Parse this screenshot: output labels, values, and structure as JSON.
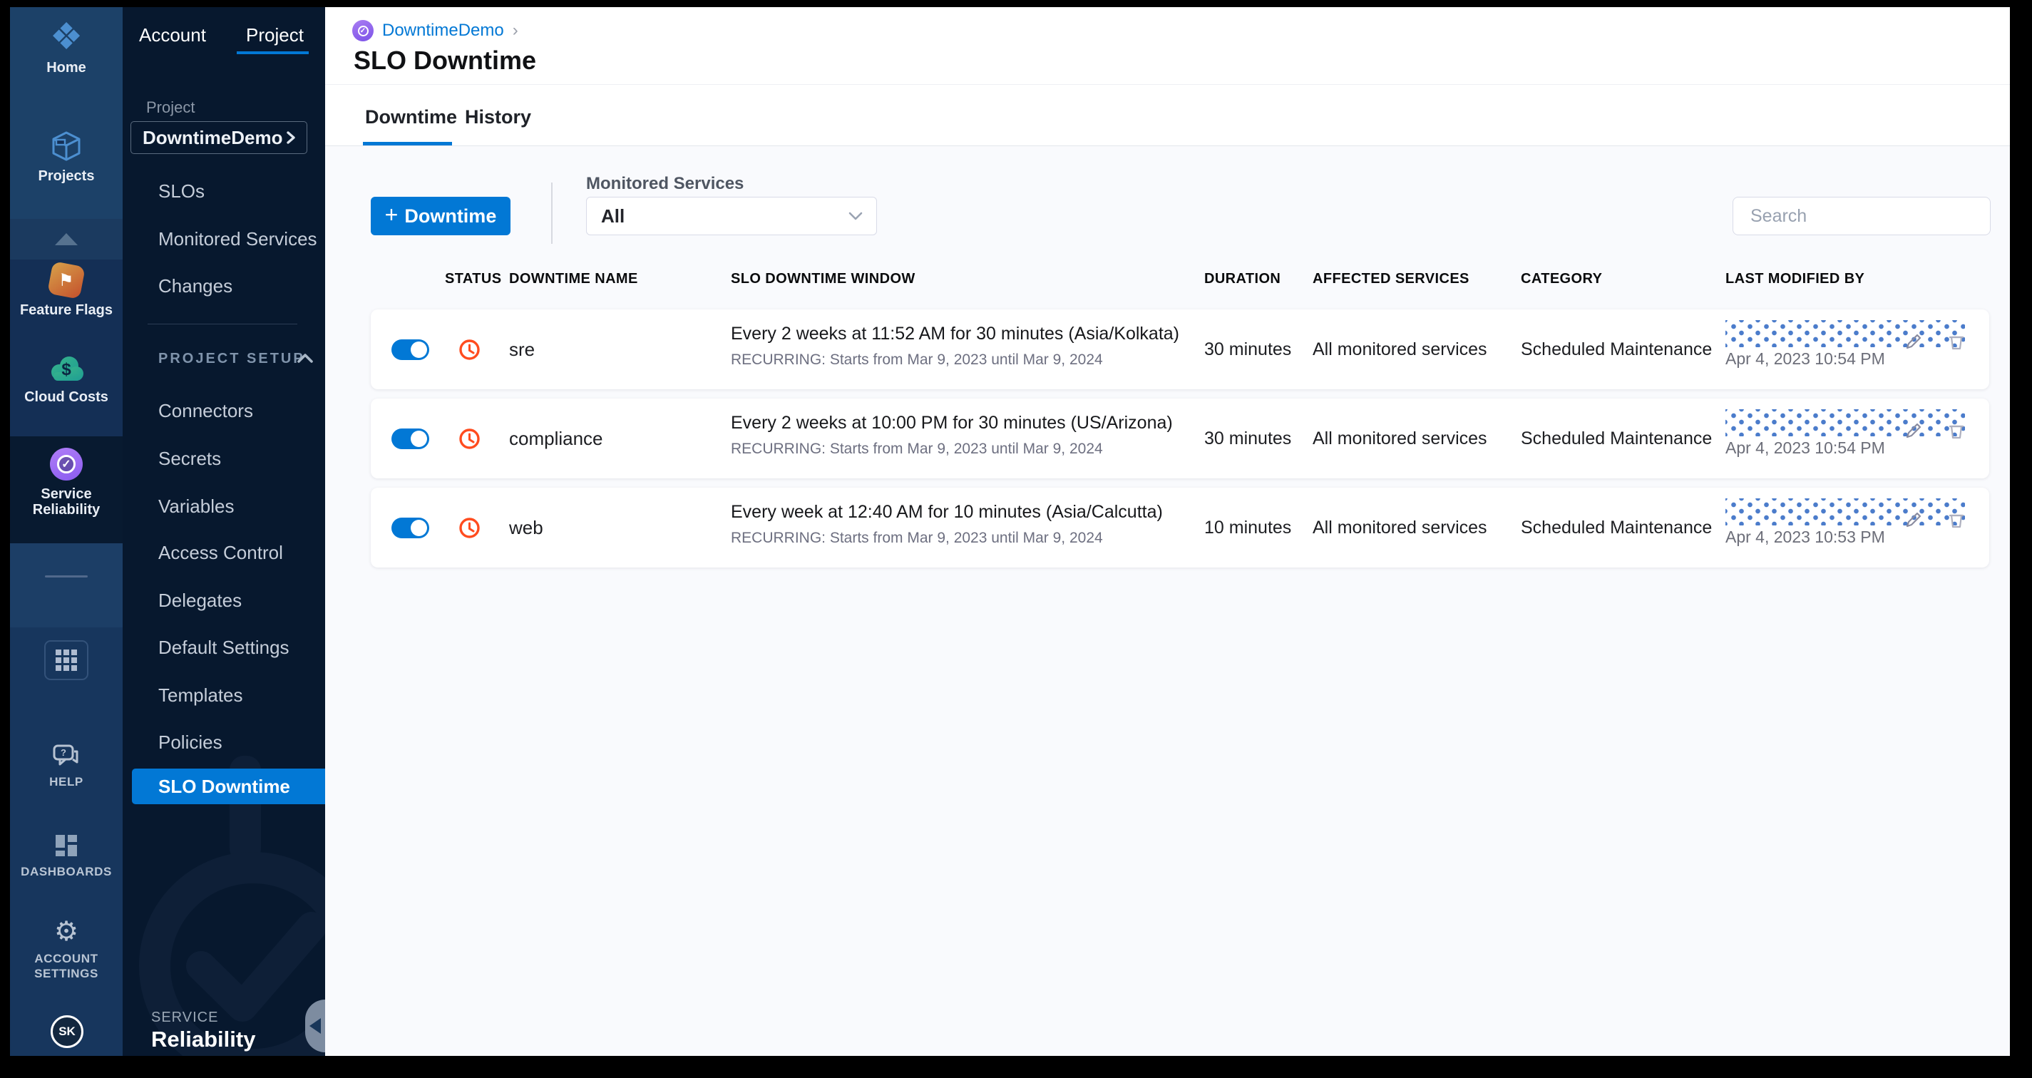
{
  "colors": {
    "accent": "#0278d5",
    "sidebar": "#1c4168",
    "nav_dark": "#07182e",
    "clock": "#ff4c1f",
    "toggle_on": "#0278d5",
    "redaction_dot": "#4b7ccb"
  },
  "sidebar_modules": {
    "home": {
      "label": "Home"
    },
    "projects": {
      "label": "Projects"
    },
    "feature_flags": {
      "label": "Feature Flags"
    },
    "cloud_costs": {
      "label": "Cloud Costs"
    },
    "service_reliability": {
      "label": "Service Reliability",
      "line1": "Service",
      "line2": "Reliability"
    },
    "help": {
      "label": "HELP"
    },
    "dashboards": {
      "label": "DASHBOARDS"
    },
    "account_settings": {
      "line1": "ACCOUNT",
      "line2": "SETTINGS"
    },
    "avatar_initials": "SK"
  },
  "project_nav": {
    "tabs": [
      {
        "label": "Account"
      },
      {
        "label": "Project",
        "active": true
      }
    ],
    "project_label": "Project",
    "project_selector_value": "DowntimeDemo",
    "project_selector_chevron": "❯",
    "items_top": [
      "SLOs",
      "Monitored Services",
      "Changes"
    ],
    "section_label": "PROJECT SETUP",
    "setup_items": [
      "Connectors",
      "Secrets",
      "Variables",
      "Access Control",
      "Delegates",
      "Default Settings",
      "Templates",
      "Policies"
    ],
    "selected_item": "SLO Downtime",
    "footer_kicker": "SERVICE",
    "footer_title": "Reliability"
  },
  "header": {
    "breadcrumb_project": "DowntimeDemo",
    "breadcrumb_chevron": "›",
    "breadcrumb_icon_glyph": "✓",
    "title": "SLO Downtime",
    "tabs": [
      {
        "label": "Downtime",
        "active": true
      },
      {
        "label": "History"
      }
    ]
  },
  "toolbar": {
    "plus_glyph": "+",
    "create_label": "Downtime",
    "filter_label": "Monitored Services",
    "filter_value": "All",
    "search_placeholder": "Search"
  },
  "table": {
    "columns": {
      "status": "STATUS",
      "name": "DOWNTIME NAME",
      "window": "SLO DOWNTIME WINDOW",
      "duration": "DURATION",
      "affected": "AFFECTED SERVICES",
      "category": "CATEGORY",
      "modified": "LAST MODIFIED BY"
    },
    "rows": [
      {
        "name": "sre",
        "enabled": true,
        "window": "Every 2 weeks at 11:52 AM for 30 minutes (Asia/Kolkata)",
        "recurrence": "RECURRING: Starts from Mar 9, 2023 until Mar 9, 2024",
        "duration": "30 minutes",
        "affected": "All monitored services",
        "category": "Scheduled Maintenance",
        "modified": "Apr 4, 2023 10:54 PM"
      },
      {
        "name": "compliance",
        "enabled": true,
        "window": "Every 2 weeks at 10:00 PM for 30 minutes (US/Arizona)",
        "recurrence": "RECURRING: Starts from Mar 9, 2023 until Mar 9, 2024",
        "duration": "30 minutes",
        "affected": "All monitored services",
        "category": "Scheduled Maintenance",
        "modified": "Apr 4, 2023 10:54 PM"
      },
      {
        "name": "web",
        "enabled": true,
        "window": "Every week at 12:40 AM for 10 minutes (Asia/Calcutta)",
        "recurrence": "RECURRING: Starts from Mar 9, 2023 until Mar 9, 2024",
        "duration": "10 minutes",
        "affected": "All monitored services",
        "category": "Scheduled Maintenance",
        "modified": "Apr 4, 2023 10:53 PM"
      }
    ]
  }
}
